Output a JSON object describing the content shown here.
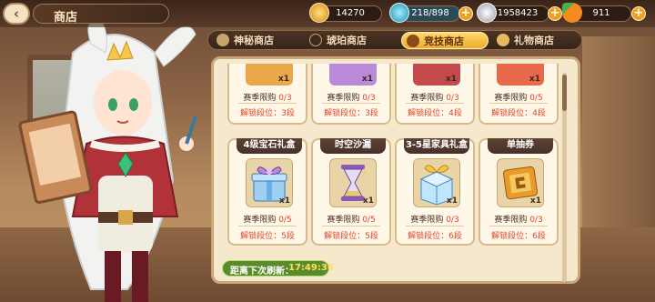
{
  "header": {
    "back_glyph": "‹",
    "title": "商店"
  },
  "resources": [
    {
      "name": "gold",
      "icon": "gold-coin-icon",
      "value": "14270",
      "color": "#f3b43a"
    },
    {
      "name": "stamina",
      "icon": "stamina-bottle-icon",
      "value": "218/898",
      "color": "#43b6d6"
    },
    {
      "name": "silver",
      "icon": "silver-coin-icon",
      "value": "1958423",
      "color": "#c9c9d4"
    },
    {
      "name": "carrot",
      "icon": "carrot-icon",
      "value": "911",
      "color": "#f07a1e"
    }
  ],
  "tabs": [
    {
      "label": "神秘商店",
      "icon": "mystic-store-icon",
      "active": false
    },
    {
      "label": "琥珀商店",
      "icon": "amber-store-icon",
      "active": false
    },
    {
      "label": "竞技商店",
      "icon": "arena-store-icon",
      "active": true
    },
    {
      "label": "礼物商店",
      "icon": "gift-store-icon",
      "active": false
    }
  ],
  "top_row": [
    {
      "icon": "item-icon",
      "qty": "x1",
      "limit_label": "赛季限购",
      "limit_count": "0/3",
      "unlock": "解锁段位：3段"
    },
    {
      "icon": "item-icon",
      "qty": "x1",
      "limit_label": "赛季限购",
      "limit_count": "0/3",
      "unlock": "解锁段位：3段"
    },
    {
      "icon": "item-icon",
      "qty": "x1",
      "limit_label": "赛季限购",
      "limit_count": "0/3",
      "unlock": "解锁段位：4段"
    },
    {
      "icon": "item-icon",
      "qty": "x1",
      "limit_label": "赛季限购",
      "limit_count": "0/5",
      "unlock": "解锁段位：4段"
    }
  ],
  "bottom_row": [
    {
      "name": "4级宝石礼盒",
      "icon": "gem-gift-box-icon",
      "qty": "x1",
      "limit_label": "赛季限购",
      "limit_count": "0/5",
      "unlock": "解锁段位：5段",
      "color": "#7fb7e8"
    },
    {
      "name": "时空沙漏",
      "icon": "hourglass-icon",
      "qty": "x1",
      "limit_label": "赛季限购",
      "limit_count": "0/5",
      "unlock": "解锁段位：5段",
      "color": "#b48ad8"
    },
    {
      "name": "3-5星家具礼盒",
      "icon": "furniture-gift-box-icon",
      "qty": "x1",
      "limit_label": "赛季限购",
      "limit_count": "0/3",
      "unlock": "解锁段位：6段",
      "color": "#7ac3e8"
    },
    {
      "name": "单抽券",
      "icon": "single-draw-ticket-icon",
      "qty": "x1",
      "limit_label": "赛季限购",
      "limit_count": "0/3",
      "unlock": "解锁段位：6段",
      "color": "#e8a83a"
    }
  ],
  "refresh": {
    "label": "距离下次刷新：",
    "time": "17:49:36"
  }
}
